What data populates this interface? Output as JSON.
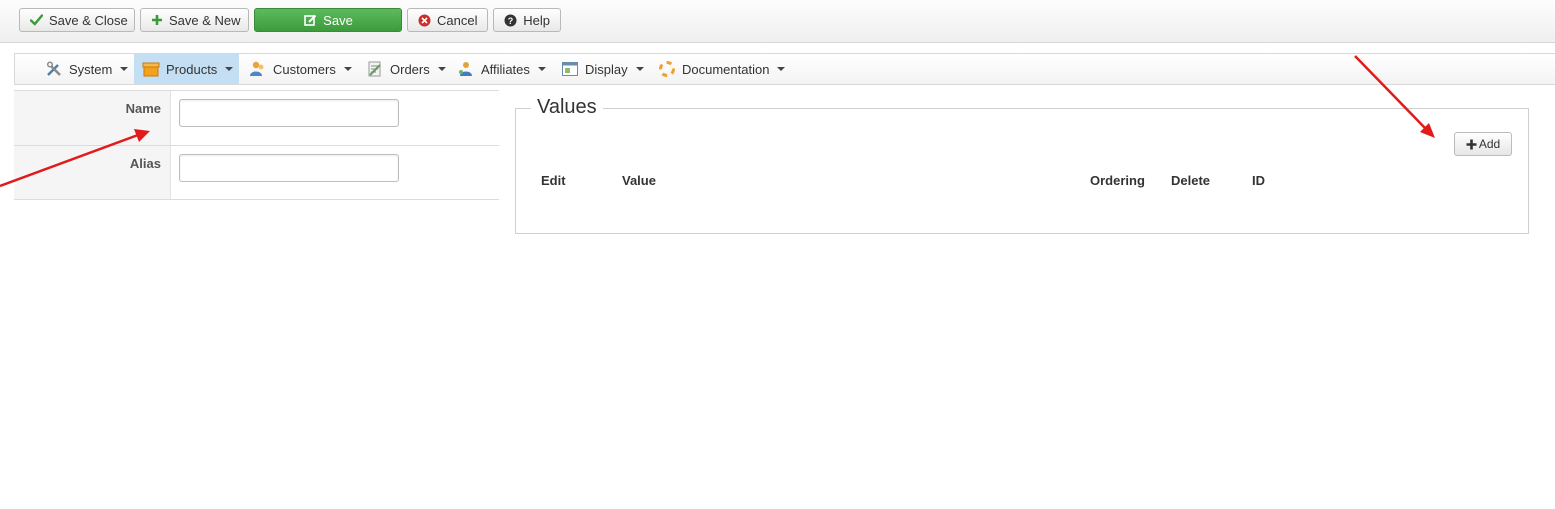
{
  "toolbar": {
    "save_close": {
      "label": "Save & Close",
      "icon": "check-icon"
    },
    "save_new": {
      "label": "Save & New",
      "icon": "plus-icon"
    },
    "save": {
      "label": "Save",
      "icon": "edit-icon"
    },
    "cancel": {
      "label": "Cancel",
      "icon": "cancel-icon"
    },
    "help": {
      "label": "Help",
      "icon": "question-icon"
    }
  },
  "menu": {
    "items": [
      {
        "label": "System",
        "icon": "tools-icon"
      },
      {
        "label": "Products",
        "icon": "box-icon",
        "active": true
      },
      {
        "label": "Customers",
        "icon": "users-icon"
      },
      {
        "label": "Orders",
        "icon": "orders-icon"
      },
      {
        "label": "Affiliates",
        "icon": "affiliates-icon"
      },
      {
        "label": "Display",
        "icon": "display-icon"
      },
      {
        "label": "Documentation",
        "icon": "lifebuoy-icon"
      }
    ]
  },
  "form": {
    "name": {
      "label": "Name",
      "value": "",
      "placeholder": ""
    },
    "alias": {
      "label": "Alias",
      "value": "",
      "placeholder": ""
    }
  },
  "values": {
    "title": "Values",
    "add_label": "Add",
    "columns": [
      "Edit",
      "Value",
      "Ordering",
      "Delete",
      "ID"
    ],
    "rows": []
  },
  "colors": {
    "save_green": "#4cae4c",
    "active_menu": "#c4dff3",
    "annotation_arrow": "#e11b1b"
  }
}
